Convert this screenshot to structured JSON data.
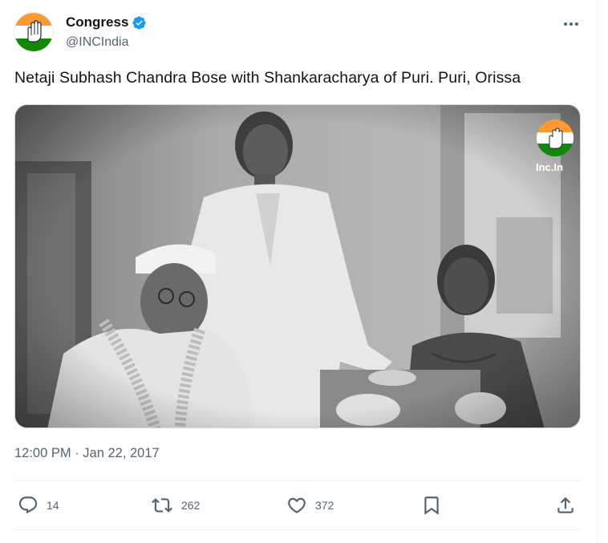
{
  "author": {
    "display_name": "Congress",
    "handle": "@INCIndia",
    "verified_icon": "verified-badge-icon"
  },
  "tweet": {
    "text": "Netaji Subhash Chandra Bose with Shankaracharya of Puri. Puri, Orissa",
    "timestamp": "12:00 PM · Jan 22, 2017"
  },
  "media": {
    "watermark_label": "Inc.In"
  },
  "actions": {
    "replies": "14",
    "retweets": "262",
    "likes": "372"
  },
  "colors": {
    "verified": "#1d9bf0",
    "text_primary": "#0f1419",
    "text_secondary": "#536471",
    "saffron": "#ff9933",
    "india_green": "#138808"
  }
}
